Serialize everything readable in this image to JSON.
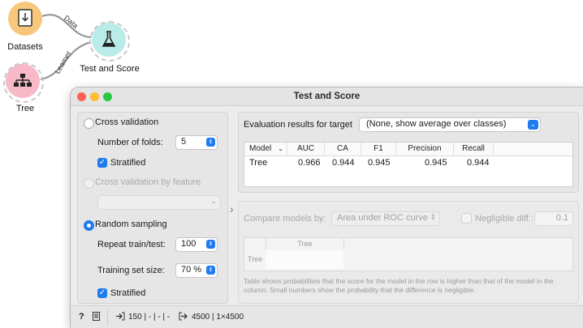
{
  "canvas": {
    "widgets": [
      {
        "label": "Datasets"
      },
      {
        "label": "Test and Score"
      },
      {
        "label": "Tree"
      }
    ],
    "links": [
      {
        "label": "Data"
      },
      {
        "label": "Learner"
      }
    ],
    "colors": {
      "datasets": "#f7c77b",
      "test_score": "#b9ebe8",
      "tree": "#f7b8c8"
    }
  },
  "window": {
    "title": "Test and Score",
    "sampling": {
      "cross_validation": "Cross validation",
      "folds_label": "Number of folds:",
      "folds_value": "5",
      "stratified_1": "Stratified",
      "cv_by_feature": "Cross validation by feature",
      "random_sampling": "Random sampling",
      "repeat_label": "Repeat train/test:",
      "repeat_value": "100",
      "train_size_label": "Training set size:",
      "train_size_value": "70 %",
      "stratified_2": "Stratified"
    },
    "evaluation": {
      "label": "Evaluation results for target",
      "target": "(None, show average over classes)",
      "columns": [
        "Model",
        "AUC",
        "CA",
        "F1",
        "Precision",
        "Recall"
      ],
      "rows": [
        {
          "model": "Tree",
          "auc": "0.966",
          "ca": "0.944",
          "f1": "0.945",
          "precision": "0.945",
          "recall": "0.944"
        }
      ]
    },
    "compare": {
      "label": "Compare models by:",
      "metric": "Area under ROC curve",
      "negligible_label": "Negligible diff.:",
      "negligible_value": "0.1",
      "col_header": "Tree",
      "row_header": "Tree",
      "note": "Table shows probabilities that the score for the model in the row is higher than that of the model in the column. Small numbers show the probability that the difference is negligible."
    },
    "status": {
      "input": "150 | - | - | -",
      "output": "4500 | 1×4500"
    }
  }
}
